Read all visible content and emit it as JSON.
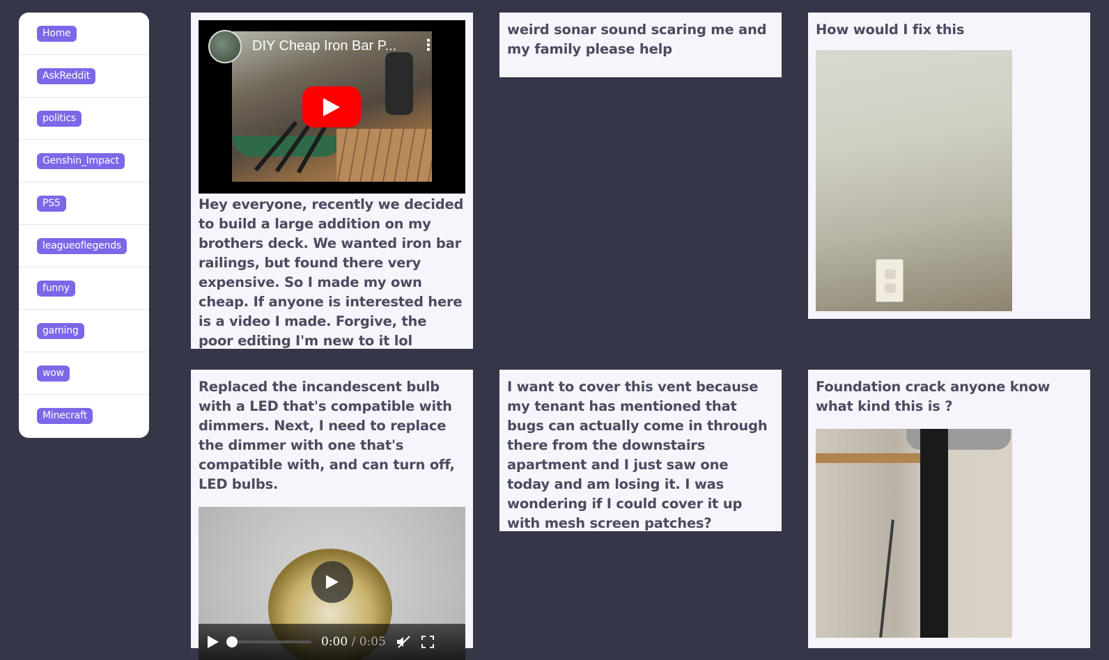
{
  "sidebar": {
    "items": [
      {
        "label": "Home"
      },
      {
        "label": "AskReddit"
      },
      {
        "label": "politics"
      },
      {
        "label": "Genshin_Impact"
      },
      {
        "label": "PS5"
      },
      {
        "label": "leagueoflegends"
      },
      {
        "label": "funny"
      },
      {
        "label": "gaming"
      },
      {
        "label": "wow"
      },
      {
        "label": "Minecraft"
      }
    ]
  },
  "posts": [
    {
      "video_title": "DIY Cheap Iron Bar P...",
      "body": "Hey everyone, recently we decided to build a large addition on my brothers deck. We wanted iron bar railings, but found there very expensive. So I made my own cheap. If anyone is interested here is a video I made. Forgive, the poor editing I'm new to it lol"
    },
    {
      "title": "weird sonar sound scaring me and my family please help"
    },
    {
      "title": "How would I fix this"
    },
    {
      "title": "Replaced the incandescent bulb with a LED that's compatible with dimmers. Next, I need to replace the dimmer with one that's compatible with, and can turn off, LED bulbs.",
      "video": {
        "current_time": "0:00",
        "separator": "/",
        "duration": "0:05"
      }
    },
    {
      "title": "I want to cover this vent because my tenant has mentioned that bugs can actually come in through there from the downstairs apartment and I just saw one today and am losing it. I was wondering if I could cover it up with mesh screen patches?"
    },
    {
      "title": "Foundation crack anyone know what kind this is ?"
    }
  ],
  "colors": {
    "background": "#363649",
    "card": "#f6f5fc",
    "tag": "#7b68e8",
    "youtube_red": "#ff0000"
  }
}
